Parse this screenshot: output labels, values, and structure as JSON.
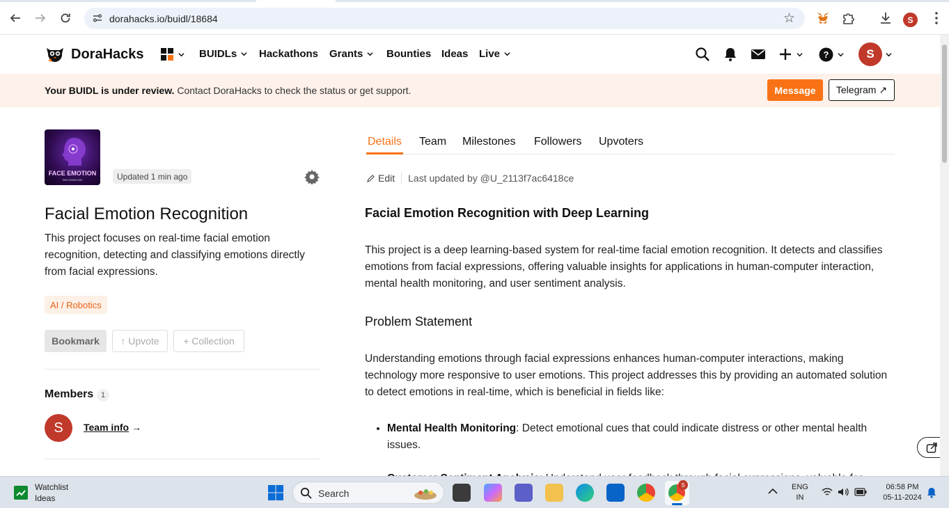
{
  "browser": {
    "url": "dorahacks.io/buidl/18684",
    "profile_initial": "S"
  },
  "header": {
    "brand": "DoraHacks",
    "nav": [
      "BUIDLs",
      "Hackathons",
      "Grants",
      "Bounties",
      "Ideas",
      "Live"
    ],
    "avatar_initial": "S"
  },
  "banner": {
    "bold": "Your BUIDL is under review.",
    "text": " Contact DoraHacks to check the status or get support.",
    "message_label": "Message",
    "telegram_label": "Telegram ↗"
  },
  "project": {
    "thumb_title": "FACE EMOTION",
    "thumb_sub": "RECOGNITION",
    "updated": "Updated 1 min ago",
    "title": "Facial Emotion Recognition",
    "description": "This project focuses on real-time facial emotion recognition, detecting and classifying emotions directly from facial expressions.",
    "tag": "AI / Robotics",
    "actions": {
      "bookmark": "Bookmark",
      "upvote": "↑ Upvote",
      "collection": "+ Collection"
    },
    "members_heading": "Members",
    "members_count": "1",
    "member_initial": "S",
    "team_info": "Team info",
    "team_info_arrow": "→"
  },
  "tabs": [
    "Details",
    "Team",
    "Milestones",
    "Followers",
    "Upvoters"
  ],
  "edit": {
    "label": "Edit",
    "last_updated": "Last updated by @U_2113f7ac6418ce"
  },
  "article": {
    "h1": "Facial Emotion Recognition with Deep Learning",
    "p1": "This project is a deep learning-based system for real-time facial emotion recognition. It detects and classifies emotions from facial expressions, offering valuable insights for applications in human-computer interaction, mental health monitoring, and user sentiment analysis.",
    "h2": "Problem Statement",
    "p2": "Understanding emotions through facial expressions enhances human-computer interactions, making technology more responsive to user emotions. This project addresses this by providing an automated solution to detect emotions in real-time, which is beneficial in fields like:",
    "bullets": [
      {
        "bold": "Mental Health Monitoring",
        "text": ": Detect emotional cues that could indicate distress or other mental health issues."
      },
      {
        "bold": "Customer Sentiment Analysis",
        "text": ": Understand user feedback through facial expressions, valuable for"
      }
    ]
  },
  "taskbar": {
    "widget_title": "Watchlist",
    "widget_sub": "Ideas",
    "search_label": "Search",
    "lang_top": "ENG",
    "lang_bottom": "IN",
    "time": "06:58 PM",
    "date": "05-11-2024",
    "chrome_badge": "S"
  }
}
